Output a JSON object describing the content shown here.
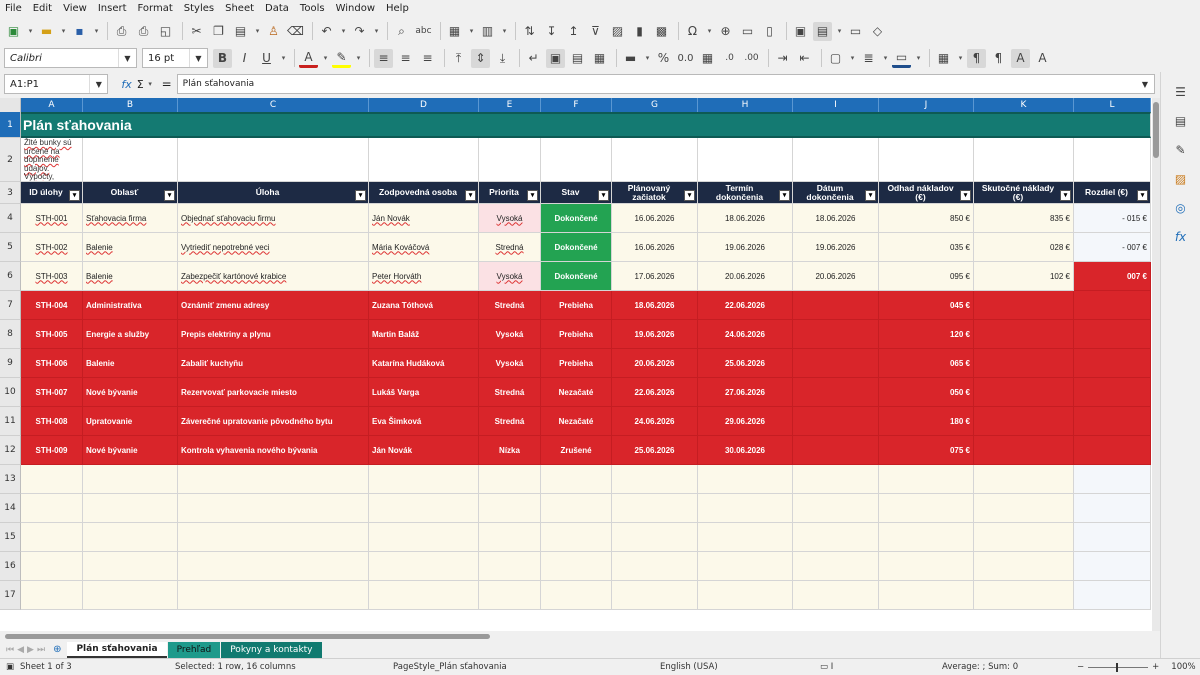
{
  "menu": [
    "File",
    "Edit",
    "View",
    "Insert",
    "Format",
    "Styles",
    "Sheet",
    "Data",
    "Tools",
    "Window",
    "Help"
  ],
  "toolbar": {
    "font_name": "Calibri",
    "font_size": "16 pt"
  },
  "formula_bar": {
    "cell_ref": "A1:P1",
    "fx": "fx",
    "sum": "Σ",
    "eq": "=",
    "content": "Plán sťahovania"
  },
  "columns": [
    "A",
    "B",
    "C",
    "D",
    "E",
    "F",
    "G",
    "H",
    "I",
    "J",
    "K",
    "L"
  ],
  "title": "Plán sťahovania",
  "note": "Žlté bunky sú určené na doplnenie údajov. Výpočty, upozornenia a kontakt sa doplňajú automaticky.",
  "headers": [
    "ID úlohy",
    "Oblasť",
    "Úloha",
    "Zodpovedná osoba",
    "Priorita",
    "Stav",
    "Plánovaný začiatok",
    "Termín dokončenia",
    "Dátum dokončenia",
    "Odhad nákladov (€)",
    "Skutočné náklady (€)",
    "Rozdiel (€)"
  ],
  "rows": [
    {
      "id": "STH-001",
      "area": "Sťahovacia firma",
      "task": "Objednať sťahovaciu firmu",
      "person": "Ján Novák",
      "prio": "Vysoká",
      "state": "Dokončené",
      "start": "16.06.2026",
      "due": "18.06.2026",
      "done": "18.06.2026",
      "est": "850 €",
      "act": "835 €",
      "diff": "- 015 €"
    },
    {
      "id": "STH-002",
      "area": "Balenie",
      "task": "Vytriediť nepotrebné veci",
      "person": "Mária Kováčová",
      "prio": "Stredná",
      "state": "Dokončené",
      "start": "16.06.2026",
      "due": "19.06.2026",
      "done": "19.06.2026",
      "est": "035 €",
      "act": "028 €",
      "diff": "- 007 €"
    },
    {
      "id": "STH-003",
      "area": "Balenie",
      "task": "Zabezpečiť kartónové krabice",
      "person": "Peter Horváth",
      "prio": "Vysoká",
      "state": "Dokončené",
      "start": "17.06.2026",
      "due": "20.06.2026",
      "done": "20.06.2026",
      "est": "095 €",
      "act": "102 €",
      "diff": "007 €"
    },
    {
      "id": "STH-004",
      "area": "Administratíva",
      "task": "Oznámiť zmenu adresy",
      "person": "Zuzana Tóthová",
      "prio": "Stredná",
      "state": "Prebieha",
      "start": "18.06.2026",
      "due": "22.06.2026",
      "done": "",
      "est": "045 €",
      "act": "",
      "diff": ""
    },
    {
      "id": "STH-005",
      "area": "Energie a služby",
      "task": "Prepis elektriny a plynu",
      "person": "Martin Baláž",
      "prio": "Vysoká",
      "state": "Prebieha",
      "start": "19.06.2026",
      "due": "24.06.2026",
      "done": "",
      "est": "120 €",
      "act": "",
      "diff": ""
    },
    {
      "id": "STH-006",
      "area": "Balenie",
      "task": "Zabaliť kuchyňu",
      "person": "Katarína Hudáková",
      "prio": "Vysoká",
      "state": "Prebieha",
      "start": "20.06.2026",
      "due": "25.06.2026",
      "done": "",
      "est": "065 €",
      "act": "",
      "diff": ""
    },
    {
      "id": "STH-007",
      "area": "Nové bývanie",
      "task": "Rezervovať parkovacie miesto",
      "person": "Lukáš Varga",
      "prio": "Stredná",
      "state": "Nezačaté",
      "start": "22.06.2026",
      "due": "27.06.2026",
      "done": "",
      "est": "050 €",
      "act": "",
      "diff": ""
    },
    {
      "id": "STH-008",
      "area": "Upratovanie",
      "task": "Záverečné upratovanie pôvodného bytu",
      "person": "Eva Šimková",
      "prio": "Stredná",
      "state": "Nezačaté",
      "start": "24.06.2026",
      "due": "29.06.2026",
      "done": "",
      "est": "180 €",
      "act": "",
      "diff": ""
    },
    {
      "id": "STH-009",
      "area": "Nové bývanie",
      "task": "Kontrola vyhavenia nového bývania",
      "person": "Ján Novák",
      "prio": "Nízka",
      "state": "Zrušené",
      "start": "25.06.2026",
      "due": "30.06.2026",
      "done": "",
      "est": "075 €",
      "act": "",
      "diff": ""
    }
  ],
  "row_numbers": [
    "1",
    "2",
    "3",
    "4",
    "5",
    "6",
    "7",
    "8",
    "9",
    "10",
    "11",
    "12",
    "13",
    "14",
    "15",
    "16",
    "17"
  ],
  "tabs": [
    "Plán sťahovania",
    "Prehľad",
    "Pokyny a kontakty"
  ],
  "status": {
    "sheet": "Sheet 1 of 3",
    "selection": "Selected: 1 row, 16 columns",
    "pagestyle": "PageStyle_Plán sťahovania",
    "lang": "English (USA)",
    "sum": "Average: ; Sum: 0",
    "zoom": "100%"
  },
  "colors": {
    "accent": "#1f6db8",
    "title": "#147a72",
    "header": "#1d2a44",
    "red": "#d9252a",
    "green": "#23a352",
    "cream": "#fcf9ea"
  }
}
